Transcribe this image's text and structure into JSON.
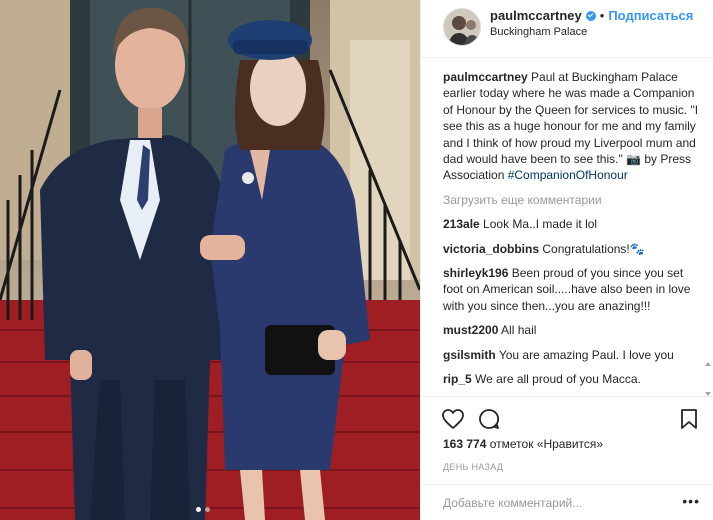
{
  "post": {
    "username": "paulmccartney",
    "separator": "•",
    "follow_label": "Подписаться",
    "location": "Buckingham Palace"
  },
  "comments": {
    "caption_user": "paulmccartney",
    "caption_text": "Paul at Buckingham Palace earlier today where he was made a Companion of Honour by the Queen for services to music. \"I see this as a huge honour for me and my family and I think of how proud my Liverpool mum and dad would have been to see this.\" 📷 by Press Association ",
    "caption_tag": "#CompanionOfHonour",
    "load_more": "Загрузить еще комментарии",
    "items": [
      {
        "user": "213ale",
        "text": "Look Ma..I made it lol"
      },
      {
        "user": "victoria_dobbins",
        "text": "Congratulations!🐾"
      },
      {
        "user": "shirleyk196",
        "text": "Been proud of you since you set foot on American soil.....have also been in love with you since then...you are anazing!!!"
      },
      {
        "user": "must2200",
        "text": "All hail"
      },
      {
        "user": "gsilsmith",
        "text": "You are amazing Paul. I love you"
      },
      {
        "user": "rip_5",
        "text": "We are all proud of you Macca."
      }
    ]
  },
  "likes": {
    "count": "163 774",
    "label": "отметок «Нравится»"
  },
  "time_ago": "ДЕНЬ НАЗАД",
  "add_comment": {
    "placeholder": "Добавьте комментарий..."
  },
  "more_label": "•••",
  "carousel": {
    "count": 2,
    "active_index": 0
  }
}
